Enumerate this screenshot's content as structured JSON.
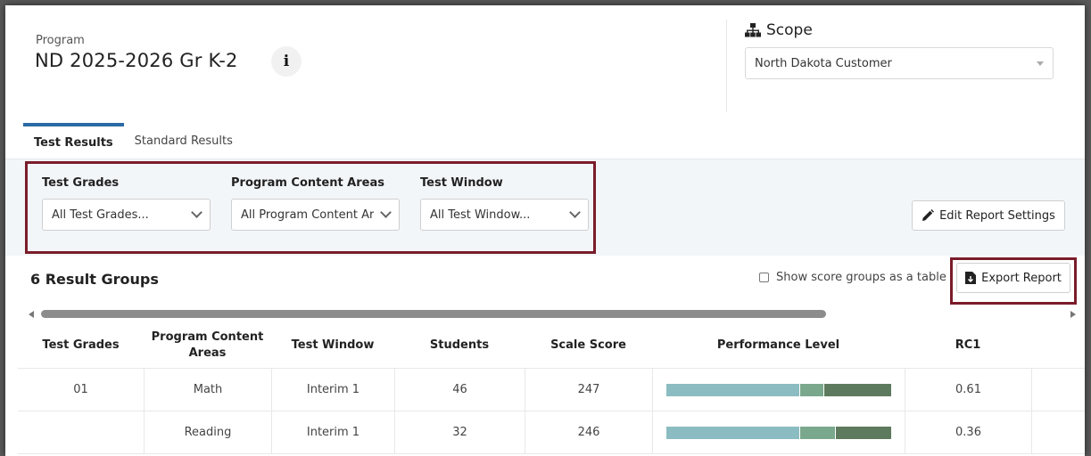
{
  "program": {
    "label": "Program",
    "name": "ND 2025-2026 Gr K-2",
    "info_icon": "info-icon"
  },
  "scope": {
    "title": "Scope",
    "icon": "sitemap-icon",
    "selected": "North Dakota Customer"
  },
  "tabs": [
    {
      "label": "Test Results",
      "active": true
    },
    {
      "label": "Standard Results",
      "active": false
    }
  ],
  "filters": {
    "grades": {
      "label": "Test Grades",
      "value": "All Test Grades..."
    },
    "content_areas": {
      "label": "Program Content Areas",
      "value": "All Program Content Ar"
    },
    "window": {
      "label": "Test Window",
      "value": "All Test Window..."
    }
  },
  "actions": {
    "edit_label": "Edit Report Settings",
    "export_label": "Export Report"
  },
  "results": {
    "title": "6 Result Groups",
    "show_table_label": "Show score groups as a table"
  },
  "colors": {
    "perf_1": "#8bbcc1",
    "perf_2": "#7aa88d",
    "perf_3": "#5e7a5e",
    "accent": "#2a6aa6",
    "highlight": "#7a1c2a"
  },
  "table": {
    "headers": [
      "Test Grades",
      "Program Content Areas",
      "Test Window",
      "Students",
      "Scale Score",
      "Performance Level",
      "RC1"
    ],
    "rows": [
      {
        "grade": "01",
        "area": "Math",
        "window": "Interim 1",
        "students": "46",
        "scale": "247",
        "perf": [
          0.59,
          0.11,
          0.3
        ],
        "rc1": "0.61"
      },
      {
        "grade": "",
        "area": "Reading",
        "window": "Interim 1",
        "students": "32",
        "scale": "246",
        "perf": [
          0.59,
          0.16,
          0.25
        ],
        "rc1": "0.36"
      }
    ]
  }
}
